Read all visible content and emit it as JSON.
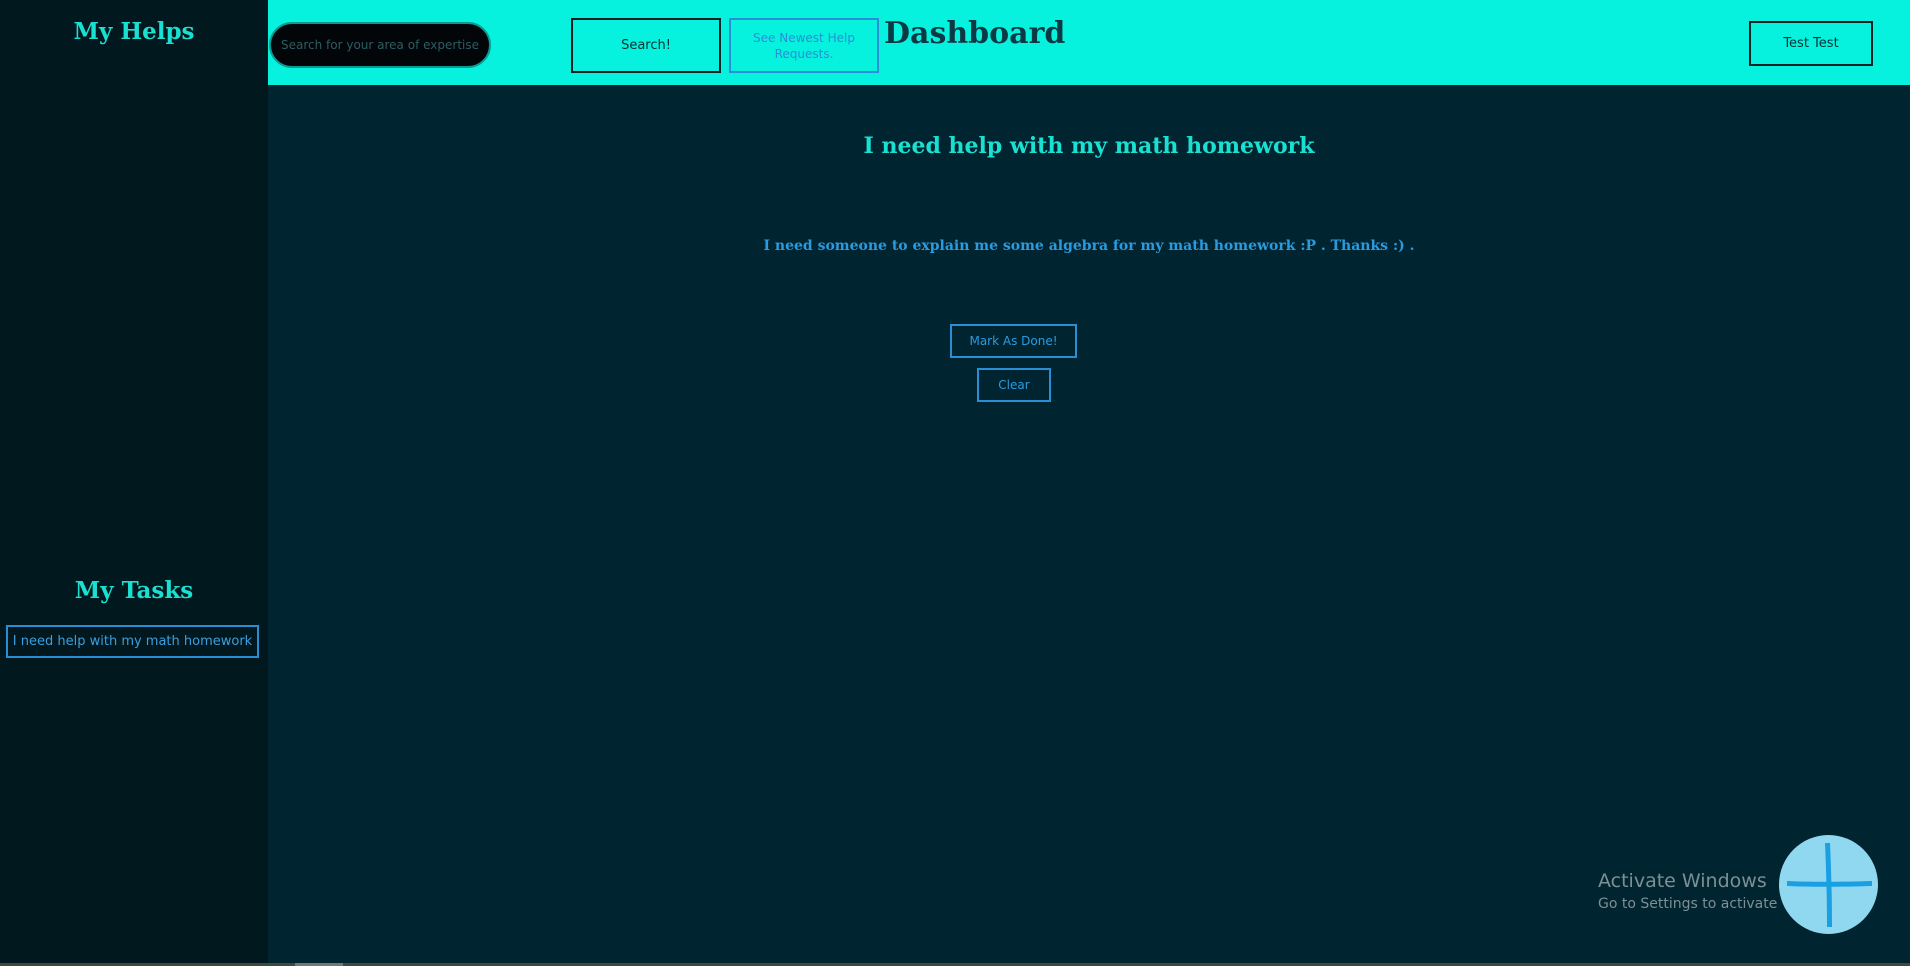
{
  "sidebar": {
    "helps_heading": "My Helps",
    "tasks_heading": "My Tasks",
    "tasks": [
      {
        "label": "I need help with my math homework"
      }
    ]
  },
  "topbar": {
    "search_placeholder": "Search for your area of expertise...",
    "search_value": "",
    "search_button": "Search!",
    "newest_button": "See Newest Help Requests.",
    "title": "Dashboard",
    "user_button": "Test Test"
  },
  "main": {
    "title": "I need help with my math homework",
    "description": "I need someone to explain me some algebra for my math homework :P . Thanks :) .",
    "mark_done_button": "Mark As Done!",
    "clear_button": "Clear"
  },
  "fab": {
    "icon": "plus-icon"
  },
  "watermark": {
    "title": "Activate Windows",
    "subtitle": "Go to Settings to activate Windows."
  },
  "colors": {
    "accent": "#06f2de",
    "background": "#002530",
    "sidebar": "#01181e",
    "heading": "#19e0d1",
    "link_blue": "#2a8ed4",
    "fab": "#8fd8ef"
  }
}
